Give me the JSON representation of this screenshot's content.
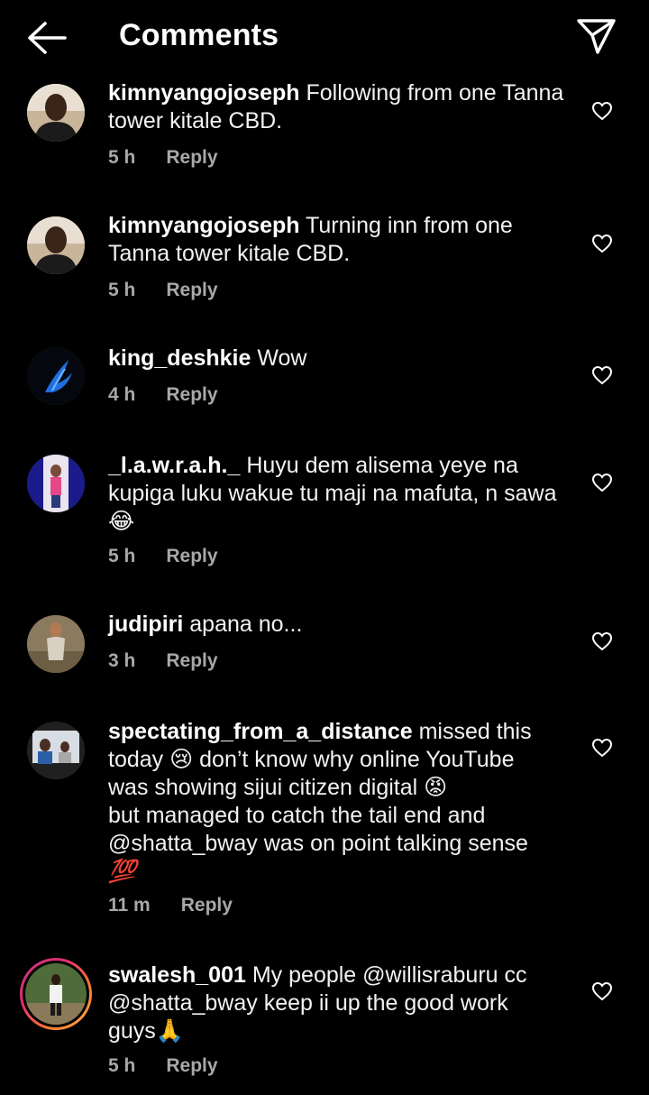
{
  "header": {
    "title": "Comments",
    "back_icon": "arrow-left-icon",
    "send_icon": "paper-plane-icon"
  },
  "comments": [
    {
      "username": "kimnyangojoseph",
      "text": "Following from one Tanna tower kitale CBD.",
      "time": "5 h",
      "reply": "Reply"
    },
    {
      "username": "kimnyangojoseph",
      "text": "Turning inn from one Tanna tower kitale CBD.",
      "time": "5 h",
      "reply": "Reply"
    },
    {
      "username": "king_deshkie",
      "text": "Wow",
      "time": "4 h",
      "reply": "Reply"
    },
    {
      "username": "_l.a.w.r.a.h._",
      "text": "Huyu dem alisema yeye na kupiga luku wakue tu maji na mafuta, n sawa",
      "emoji": "😂",
      "time": "5 h",
      "reply": "Reply"
    },
    {
      "username": "judipiri",
      "text": "apana no...",
      "time": "3 h",
      "reply": "Reply"
    },
    {
      "username": "spectating_from_a_distance",
      "text_1": "missed this",
      "text_2": "today",
      "emoji_1": "😢",
      "text_3": "don’t know why online YouTube",
      "text_4": "was showing sijui citizen digital",
      "emoji_2": "😡",
      "text_5": "but managed to catch the tail end and",
      "text_6": "@shatta_bway was on point talking sense",
      "emoji_3": "💯",
      "time": "11 m",
      "reply": "Reply"
    },
    {
      "username": "swalesh_001",
      "text_1": "My people @willisraburu cc",
      "text_2": "@shatta_bway keep ii up the good work",
      "text_3": "guys",
      "emoji": "🙏",
      "time": "5 h",
      "reply": "Reply"
    }
  ],
  "colors": {
    "background": "#000000",
    "secondary_text": "#a8a8a8",
    "story_ring": "#e1306c"
  }
}
